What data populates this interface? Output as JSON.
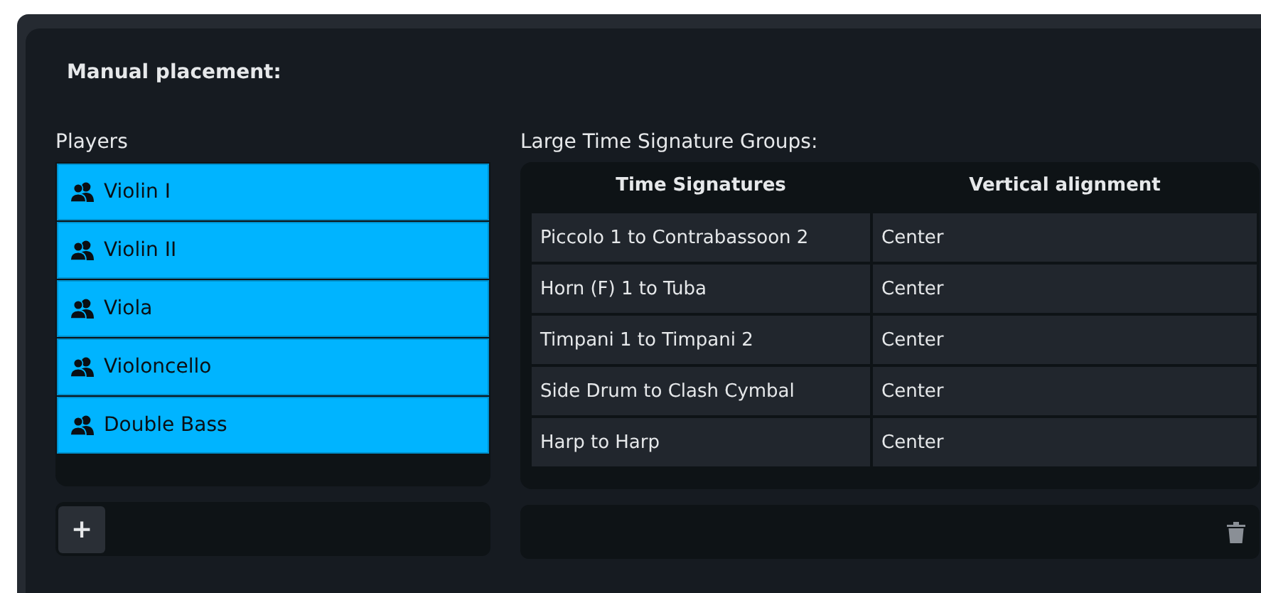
{
  "section": {
    "title": "Manual placement:"
  },
  "players": {
    "label": "Players",
    "items": [
      {
        "name": "Violin I",
        "selected": true
      },
      {
        "name": "Violin II",
        "selected": true
      },
      {
        "name": "Viola",
        "selected": true
      },
      {
        "name": "Violoncello",
        "selected": true
      },
      {
        "name": "Double Bass",
        "selected": true
      }
    ],
    "add_button": "+"
  },
  "groups": {
    "label": "Large Time Signature Groups:",
    "columns": [
      "Time Signatures",
      "Vertical alignment"
    ],
    "rows": [
      {
        "cells": [
          "Piccolo 1 to Contrabassoon 2",
          "Center"
        ]
      },
      {
        "cells": [
          "Horn (F) 1 to Tuba",
          "Center"
        ]
      },
      {
        "cells": [
          "Timpani 1 to Timpani 2",
          "Center"
        ]
      },
      {
        "cells": [
          "Side Drum to Clash Cymbal",
          "Center"
        ]
      },
      {
        "cells": [
          "Harp to Harp",
          "Center"
        ]
      }
    ]
  }
}
